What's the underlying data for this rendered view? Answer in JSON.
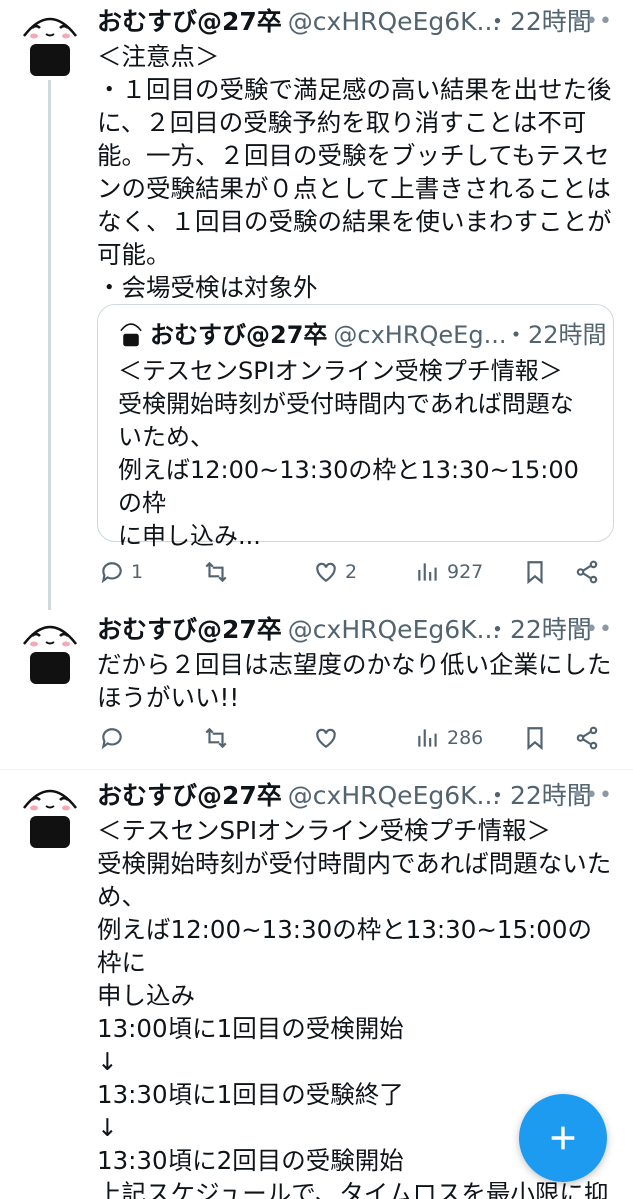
{
  "tweet1": {
    "name": "おむすび@27卒",
    "handle": "@cxHRQeEg6K...",
    "time": "・22時間",
    "more": "•••",
    "text": "＜注意点＞\n・１回目の受験で満足感の高い結果を出せた後\nに、２回目の受験予約を取り消すことは不可\n能。一方、２回目の受験をブッチしてもテスセ\nンの受験結果が０点として上書きされることは\nなく、１回目の受験の結果を使いまわすことが\n可能。\n・会場受検は対象外",
    "quote": {
      "name": "おむすび@27卒",
      "handle": "@cxHRQeEg...",
      "time": "・22時間",
      "text": "＜テスセンSPIオンライン受検プチ情報＞\n受検開始時刻が受付時間内であれば問題な\nいため、\n例えば12:00~13:30の枠と13:30~15:00の枠\nに申し込み..."
    },
    "replies": "1",
    "retweets": "",
    "likes": "2",
    "views": "927"
  },
  "tweet2": {
    "name": "おむすび@27卒",
    "handle": "@cxHRQeEg6K...",
    "time": "・22時間",
    "more": "•••",
    "text": "だから２回目は志望度のかなり低い企業にした\nほうがいい!!",
    "replies": "",
    "retweets": "",
    "likes": "",
    "views": "286"
  },
  "tweet3": {
    "name": "おむすび@27卒",
    "handle": "@cxHRQeEg6K...",
    "time": "・22時間",
    "more": "•••",
    "text": "＜テスセンSPIオンライン受検プチ情報＞\n受検開始時刻が受付時間内であれば問題ないた\nめ、\n例えば12:00~13:30の枠と13:30~15:00の枠に\n申し込み\n13:00頃に1回目の受検開始\n↓\n13:30頃に1回目の受験終了\n↓\n13:30頃に2回目の受験開始\n上記スケジュールで、タイムロスを最小限に抑\nえることができる!"
  },
  "fab": {
    "icon": "plus-icon"
  },
  "colors": {
    "accent": "#1d9bf0",
    "muted": "#536471",
    "text": "#0f1419",
    "border": "#cfd9de"
  }
}
